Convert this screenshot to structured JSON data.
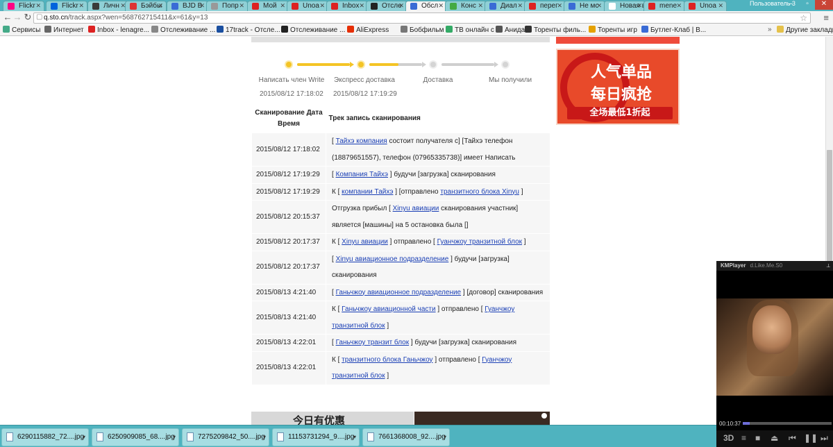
{
  "browser": {
    "tabs": [
      {
        "label": "Flickr",
        "fav": "#ff0084"
      },
      {
        "label": "Flickr",
        "fav": "#0063dc"
      },
      {
        "label": "Личн",
        "fav": "#3a3a3a"
      },
      {
        "label": "Бэйбы",
        "fav": "#d33"
      },
      {
        "label": "BJD B",
        "fav": "#3a6bd5"
      },
      {
        "label": "Попр",
        "fav": "#999"
      },
      {
        "label": "Мой",
        "fav": "#d22"
      },
      {
        "label": "Unoa",
        "fav": "#d22"
      },
      {
        "label": "Inbox",
        "fav": "#d22"
      },
      {
        "label": "Отсле",
        "fav": "#222"
      },
      {
        "label": "Обсл",
        "fav": "#3a6bd5"
      },
      {
        "label": "Конс",
        "fav": "#4a4"
      },
      {
        "label": "Диал",
        "fav": "#3a6bd5"
      },
      {
        "label": "перег",
        "fav": "#d22"
      },
      {
        "label": "Не мс",
        "fav": "#3a6bd5"
      },
      {
        "label": "Новая в",
        "fav": "#fff"
      },
      {
        "label": "mene",
        "fav": "#d22"
      },
      {
        "label": "Unoa",
        "fav": "#d22"
      }
    ],
    "user_label": "Пользователь 3",
    "url_prefix": "q.sto.cn",
    "url_rest": "/track.aspx?wen=568762715411&x=61&y=13",
    "bookmarks": [
      {
        "label": "Сервисы",
        "icon": "#4a8"
      },
      {
        "label": "Интернет",
        "icon": "#666"
      },
      {
        "label": "Inbox - lenagre...",
        "icon": "#d22"
      },
      {
        "label": "Отслеживание ...",
        "icon": "#888"
      },
      {
        "label": "17track - Отсле...",
        "icon": "#1a4fa0"
      },
      {
        "label": "Отслеживание ...",
        "icon": "#222"
      },
      {
        "label": "AliExpress",
        "icon": "#e62e04"
      },
      {
        "label": "Бобфильм",
        "icon": "#777"
      },
      {
        "label": "ТВ онлайн с",
        "icon": "#3a6"
      },
      {
        "label": "Анидаб",
        "icon": "#555"
      },
      {
        "label": "Торенты филь...",
        "icon": "#333"
      },
      {
        "label": "Торенты игр",
        "icon": "#e5a100"
      },
      {
        "label": "Бутлег-Клаб | В...",
        "icon": "#3a6bd5"
      }
    ],
    "other_bookmarks": "Другие закладки"
  },
  "tracking": {
    "steps": [
      {
        "label": "Написать член Write",
        "time": "2015/08/12 17:18:02",
        "done": true
      },
      {
        "label": "Экспресс доставка",
        "time": "2015/08/12 17:19:29",
        "done": true
      },
      {
        "label": "Доставка",
        "time": "",
        "done": false
      },
      {
        "label": "Мы получили",
        "time": "",
        "done": false
      }
    ],
    "table_headers": {
      "datetime": "Сканирование Дата Время",
      "record": "Трек запись сканирования"
    },
    "rows": [
      {
        "date": "2015/08/12 17:18:02",
        "parts": [
          {
            "t": "[ "
          },
          {
            "t": "Тайхэ компания",
            "link": true
          },
          {
            "t": " состоит получателя с] [Тайхэ телефон (18879651557), телефон (07965335738)] имеет Написать"
          }
        ]
      },
      {
        "date": "2015/08/12 17:19:29",
        "parts": [
          {
            "t": "[ "
          },
          {
            "t": "Компания Тайхэ",
            "link": true
          },
          {
            "t": " ] будучи [загрузка] сканирования"
          }
        ]
      },
      {
        "date": "2015/08/12 17:19:29",
        "parts": [
          {
            "t": "К [ "
          },
          {
            "t": "компании Тайхэ",
            "link": true
          },
          {
            "t": " ] [отправлено "
          },
          {
            "t": "транзитного блока Xinyu",
            "link": true
          },
          {
            "t": " ]"
          }
        ]
      },
      {
        "date": "2015/08/12 20:15:37",
        "parts": [
          {
            "t": "Отгрузка прибыл [ "
          },
          {
            "t": "Xinyu авиации",
            "link": true
          },
          {
            "t": " сканирования участник] является [машины] на 5 остановка была []"
          }
        ]
      },
      {
        "date": "2015/08/12 20:17:37",
        "parts": [
          {
            "t": "К [ "
          },
          {
            "t": "Xinyu авиации",
            "link": true
          },
          {
            "t": " ] отправлено [ "
          },
          {
            "t": "Гуанчжоу транзитной блок",
            "link": true
          },
          {
            "t": " ]"
          }
        ]
      },
      {
        "date": "2015/08/12 20:17:37",
        "parts": [
          {
            "t": "[ "
          },
          {
            "t": "Xinyu авиационное подразделение",
            "link": true
          },
          {
            "t": " ] будучи [загрузка] сканирования"
          }
        ]
      },
      {
        "date": "2015/08/13 4:21:40",
        "parts": [
          {
            "t": "[ "
          },
          {
            "t": "Ганьчжоу авиационное подразделение",
            "link": true
          },
          {
            "t": " ] [договор] сканирования"
          }
        ]
      },
      {
        "date": "2015/08/13 4:21:40",
        "parts": [
          {
            "t": "К [ "
          },
          {
            "t": "Ганьчжоу авиационной части",
            "link": true
          },
          {
            "t": " ] отправлено [ "
          },
          {
            "t": "Гуанчжоу транзитной блок",
            "link": true
          },
          {
            "t": " ]"
          }
        ]
      },
      {
        "date": "2015/08/13 4:22:01",
        "parts": [
          {
            "t": "[ "
          },
          {
            "t": "Ганьчжоу транзит блок",
            "link": true
          },
          {
            "t": " ] будучи [загрузка] сканирования"
          }
        ]
      },
      {
        "date": "2015/08/13 4:22:01",
        "parts": [
          {
            "t": "К [ "
          },
          {
            "t": "транзитного блока Ганьчжоу",
            "link": true
          },
          {
            "t": " ] отправлено [ "
          },
          {
            "t": "Гуанчжоу транзитной блок",
            "link": true
          },
          {
            "t": " ]"
          }
        ]
      }
    ]
  },
  "ad": {
    "line1": "人气单品",
    "line2": "每日疯抢",
    "line3": "全场最低1折起",
    "bottom_text": "今日有优惠"
  },
  "kmplayer": {
    "title": "KMPlayer",
    "track": "d.Like.Me.S0",
    "time": "00:10:37",
    "position_fraction": 0.08
  },
  "downloads": [
    "6290115882_72....jpg",
    "6250909085_68....jpg",
    "7275209842_50....jpg",
    "11153731294_9....jpg",
    "7661368008_92....jpg"
  ]
}
